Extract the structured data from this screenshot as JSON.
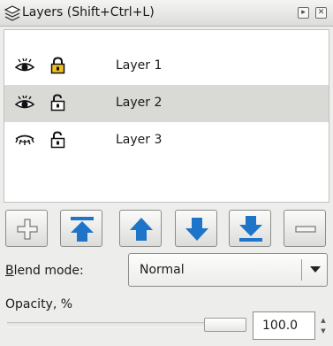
{
  "window": {
    "title": "Layers (Shift+Ctrl+L)",
    "icons": [
      "layers-icon",
      "dock-icon",
      "close-icon"
    ]
  },
  "layers": [
    {
      "name": "Layer 1",
      "visible": true,
      "locked": true,
      "selected": false
    },
    {
      "name": "Layer 2",
      "visible": true,
      "locked": false,
      "selected": true
    },
    {
      "name": "Layer 3",
      "visible": false,
      "locked": false,
      "selected": false
    }
  ],
  "toolbar": {
    "buttons": [
      {
        "name": "add-layer",
        "icon": "plus-icon"
      },
      {
        "name": "raise-to-top",
        "icon": "arrow-up-bar-icon"
      },
      {
        "name": "raise",
        "icon": "arrow-up-icon"
      },
      {
        "name": "lower",
        "icon": "arrow-down-icon"
      },
      {
        "name": "lower-to-bottom",
        "icon": "arrow-down-bar-icon"
      },
      {
        "name": "delete-layer",
        "icon": "minus-icon"
      }
    ],
    "accent_color": "#1e74c8"
  },
  "blend": {
    "label_mnemonic": "B",
    "label_rest": "lend mode:",
    "value": "Normal"
  },
  "opacity": {
    "label": "Opacity, %",
    "value": "100.0",
    "level": 1.0
  }
}
